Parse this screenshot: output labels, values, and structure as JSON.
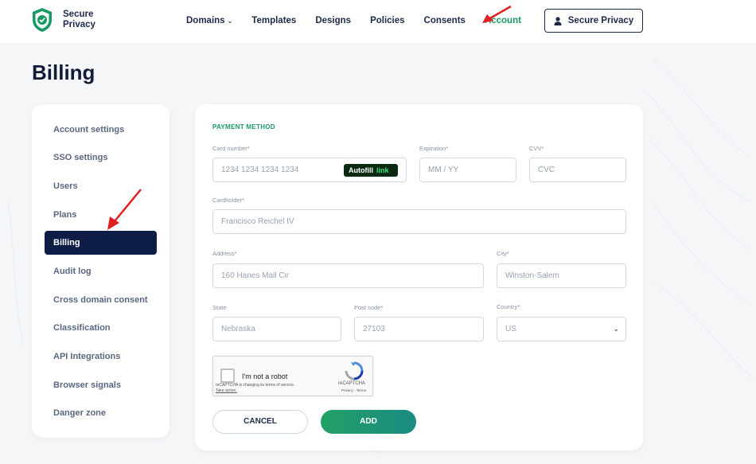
{
  "header": {
    "logo": {
      "line1": "Secure",
      "line2": "Privacy",
      "icon": "shield-check-icon"
    },
    "nav": [
      {
        "label": "Domains",
        "caret": "⌄"
      },
      {
        "label": "Templates"
      },
      {
        "label": "Designs"
      },
      {
        "label": "Policies"
      },
      {
        "label": "Consents"
      },
      {
        "label": "Account",
        "active": true
      }
    ],
    "user_button": {
      "label": "Secure Privacy",
      "icon": "user-icon"
    }
  },
  "page": {
    "title": "Billing"
  },
  "sidebar": {
    "items": [
      {
        "label": "Account settings"
      },
      {
        "label": "SSO settings"
      },
      {
        "label": "Users"
      },
      {
        "label": "Plans"
      },
      {
        "label": "Billing",
        "active": true
      },
      {
        "label": "Audit log"
      },
      {
        "label": "Cross domain consent"
      },
      {
        "label": "Classification"
      },
      {
        "label": "API Integrations"
      },
      {
        "label": "Browser signals"
      },
      {
        "label": "Danger zone"
      }
    ]
  },
  "payment": {
    "section_title": "PAYMENT METHOD",
    "card_number": {
      "label": "Card number*",
      "placeholder": "1234 1234 1234 1234"
    },
    "autofill": {
      "label": "Autofill",
      "link": "link"
    },
    "expiration": {
      "label": "Expiration*",
      "placeholder": "MM / YY"
    },
    "cvv": {
      "label": "CVV*",
      "placeholder": "CVC"
    },
    "cardholder": {
      "label": "Cardholder*",
      "value": "Francisco Reichel IV"
    },
    "address": {
      "label": "Address*",
      "value": "160 Hanes Mall Cir"
    },
    "city": {
      "label": "City*",
      "value": "Winston-Salem"
    },
    "state": {
      "label": "State",
      "value": "Nebraska"
    },
    "post_code": {
      "label": "Post code*",
      "value": "27103"
    },
    "country": {
      "label": "Country*",
      "value": "US"
    },
    "recaptcha": {
      "checkbox_label": "I'm not a robot",
      "notice": "reCAPTCHA is changing its terms of service.",
      "notice_link": "Take action.",
      "brand": "reCAPTCHA",
      "links": "Privacy - Terms"
    },
    "cancel_label": "CANCEL",
    "add_label": "ADD"
  },
  "colors": {
    "accent_green": "#1a9a63",
    "navy": "#0e1d45",
    "annotation_red": "#e02020"
  }
}
